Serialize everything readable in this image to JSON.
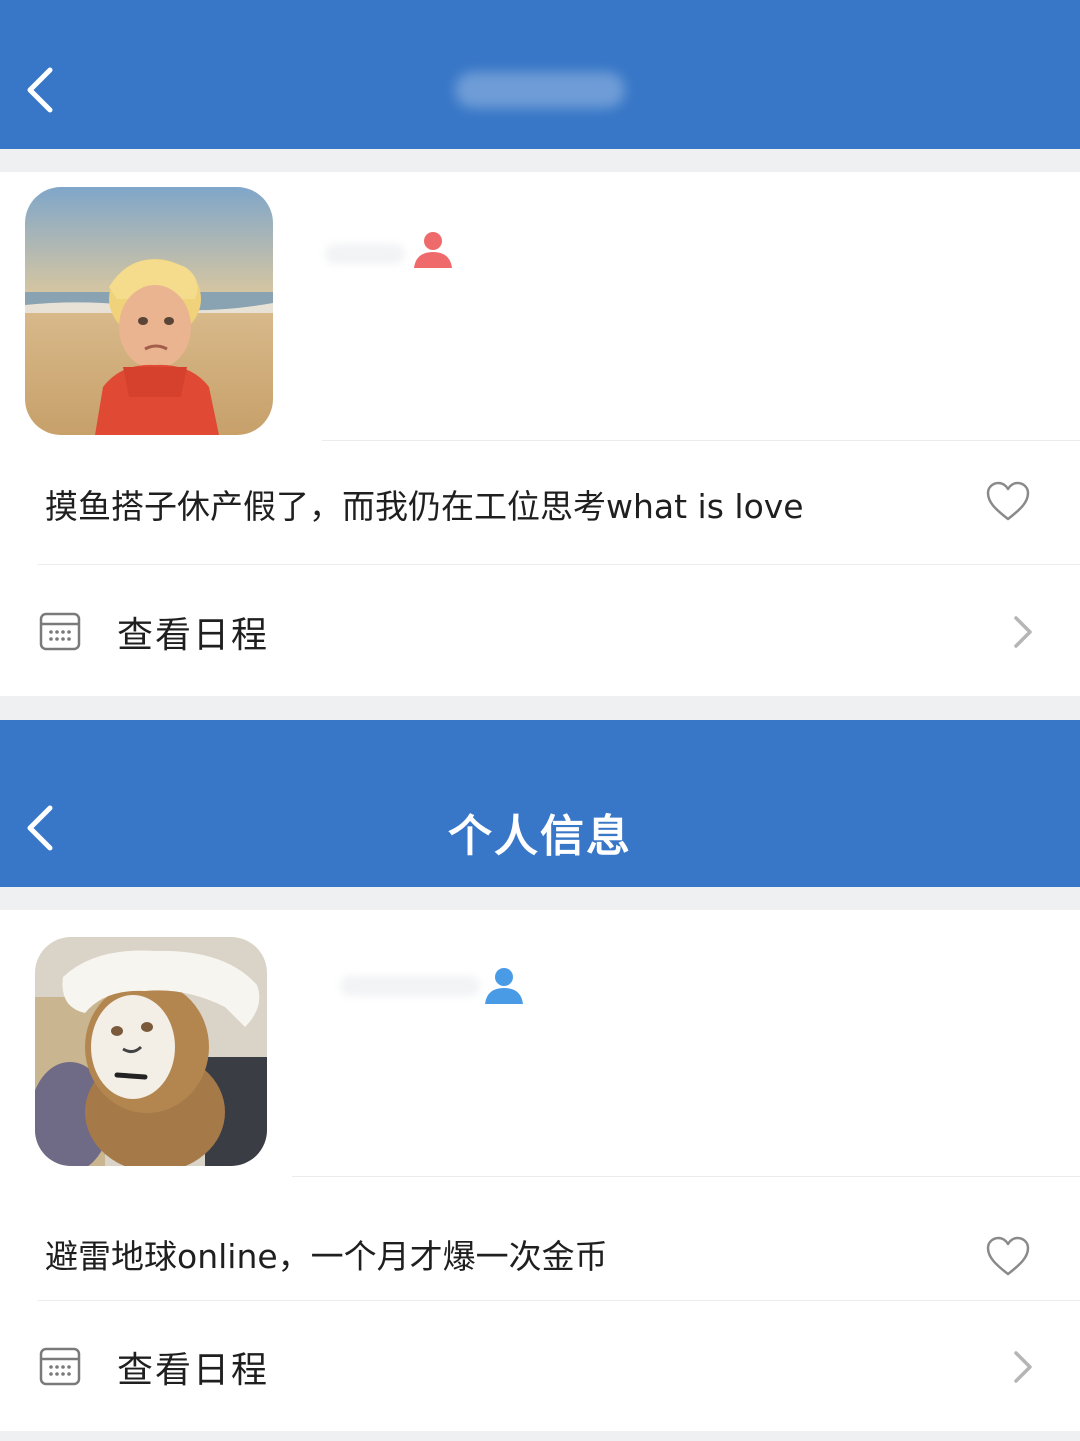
{
  "screens": [
    {
      "header": {
        "title": "",
        "title_blurred": true
      },
      "profile": {
        "avatar": "avatar-photo-child-on-beach",
        "gender_icon": "female-user-icon",
        "gender_color": "#ef6b6b",
        "signature": "摸鱼搭子休产假了，而我仍在工位思考what is love"
      },
      "schedule": {
        "label": "查看日程"
      }
    },
    {
      "header": {
        "title": "个人信息"
      },
      "profile": {
        "avatar": "avatar-photo-plush-toy-with-face-mask",
        "gender_icon": "male-user-icon",
        "gender_color": "#4a9be6",
        "signature": "避雷地球online，一个月才爆一次金币"
      },
      "schedule": {
        "label": "查看日程"
      }
    }
  ],
  "colors": {
    "header_bg": "#3877c7",
    "page_bg": "#eef0f2",
    "card_bg": "#ffffff"
  }
}
